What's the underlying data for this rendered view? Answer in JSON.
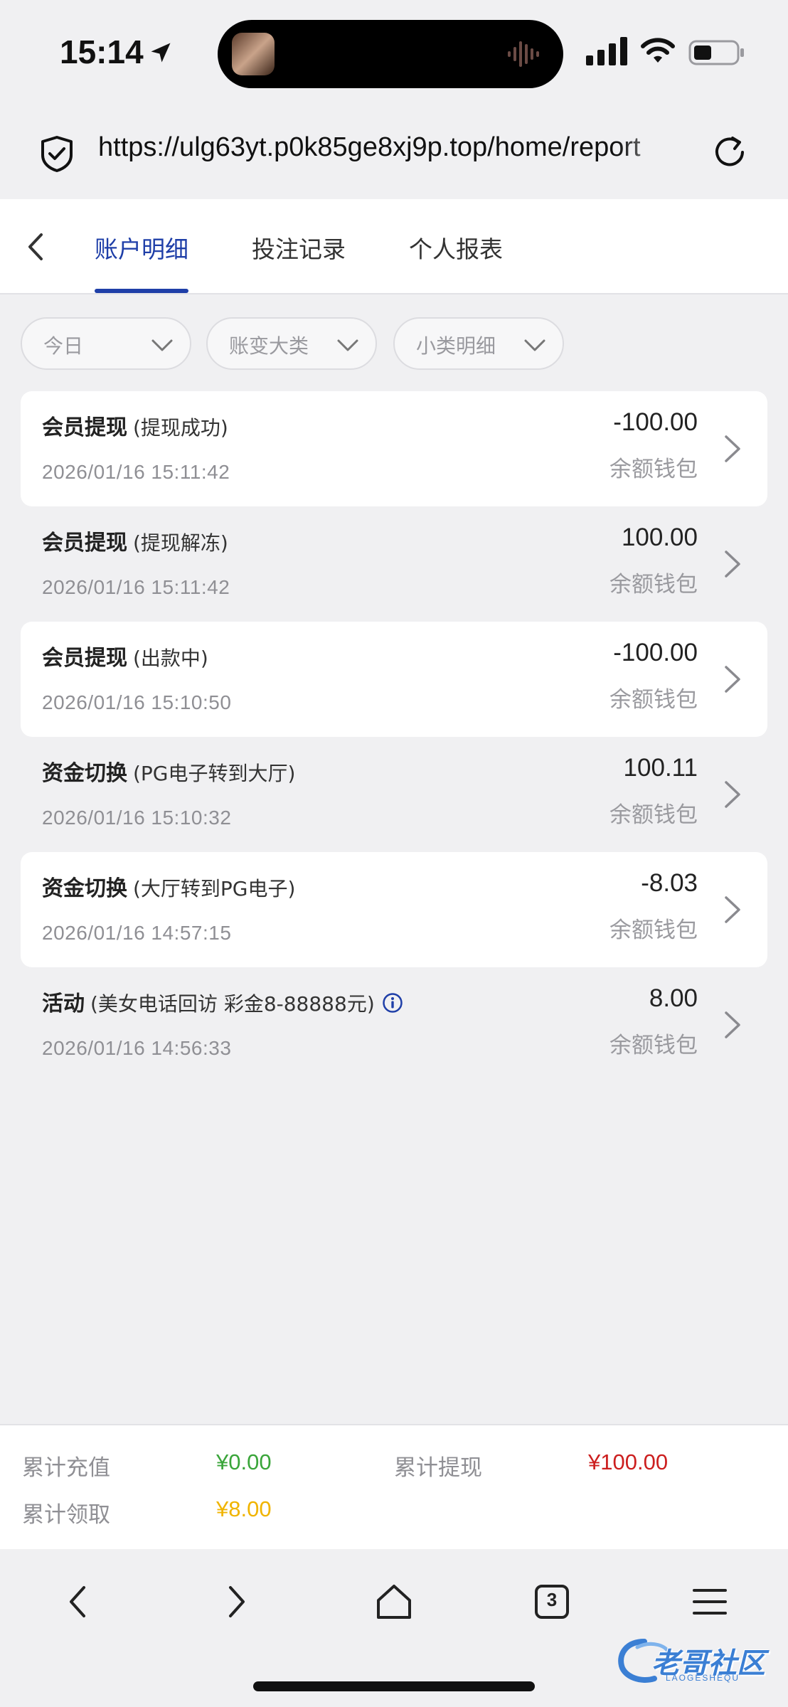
{
  "status_bar": {
    "time": "15:14"
  },
  "browser": {
    "url": "https://ulg63yt.p0k85ge8xj9p.top/home/report",
    "tabs_count": "3"
  },
  "tabs": [
    {
      "label": "账户明细",
      "active": true
    },
    {
      "label": "投注记录",
      "active": false
    },
    {
      "label": "个人报表",
      "active": false
    }
  ],
  "filters": [
    {
      "label": "今日"
    },
    {
      "label": "账变大类"
    },
    {
      "label": "小类明细"
    }
  ],
  "records": [
    {
      "title": "会员提现",
      "sub": "(提现成功)",
      "date": "2026/01/16 15:11:42",
      "amount": "-100.00",
      "wallet": "余额钱包"
    },
    {
      "title": "会员提现",
      "sub": "(提现解冻)",
      "date": "2026/01/16 15:11:42",
      "amount": "100.00",
      "wallet": "余额钱包"
    },
    {
      "title": "会员提现",
      "sub": "(出款中)",
      "date": "2026/01/16 15:10:50",
      "amount": "-100.00",
      "wallet": "余额钱包"
    },
    {
      "title": "资金切换",
      "sub": "(PG电子转到大厅)",
      "date": "2026/01/16 15:10:32",
      "amount": "100.11",
      "wallet": "余额钱包"
    },
    {
      "title": "资金切换",
      "sub": "(大厅转到PG电子)",
      "date": "2026/01/16 14:57:15",
      "amount": "-8.03",
      "wallet": "余额钱包"
    },
    {
      "title": "活动",
      "sub": "(美女电话回访 彩金8-88888元)",
      "date": "2026/01/16 14:56:33",
      "amount": "8.00",
      "wallet": "余额钱包"
    }
  ],
  "summary": {
    "deposit_label": "累计充值",
    "deposit_value": "¥0.00",
    "withdraw_label": "累计提现",
    "withdraw_value": "¥100.00",
    "claim_label": "累计领取",
    "claim_value": "¥8.00"
  },
  "colors": {
    "accent": "#1f3fa8",
    "deposit": "#3aa53a",
    "withdraw": "#cc1f1f",
    "claim": "#f0b400"
  },
  "watermark": {
    "text": "老哥社区",
    "sub": "LAOGESHEQU"
  }
}
